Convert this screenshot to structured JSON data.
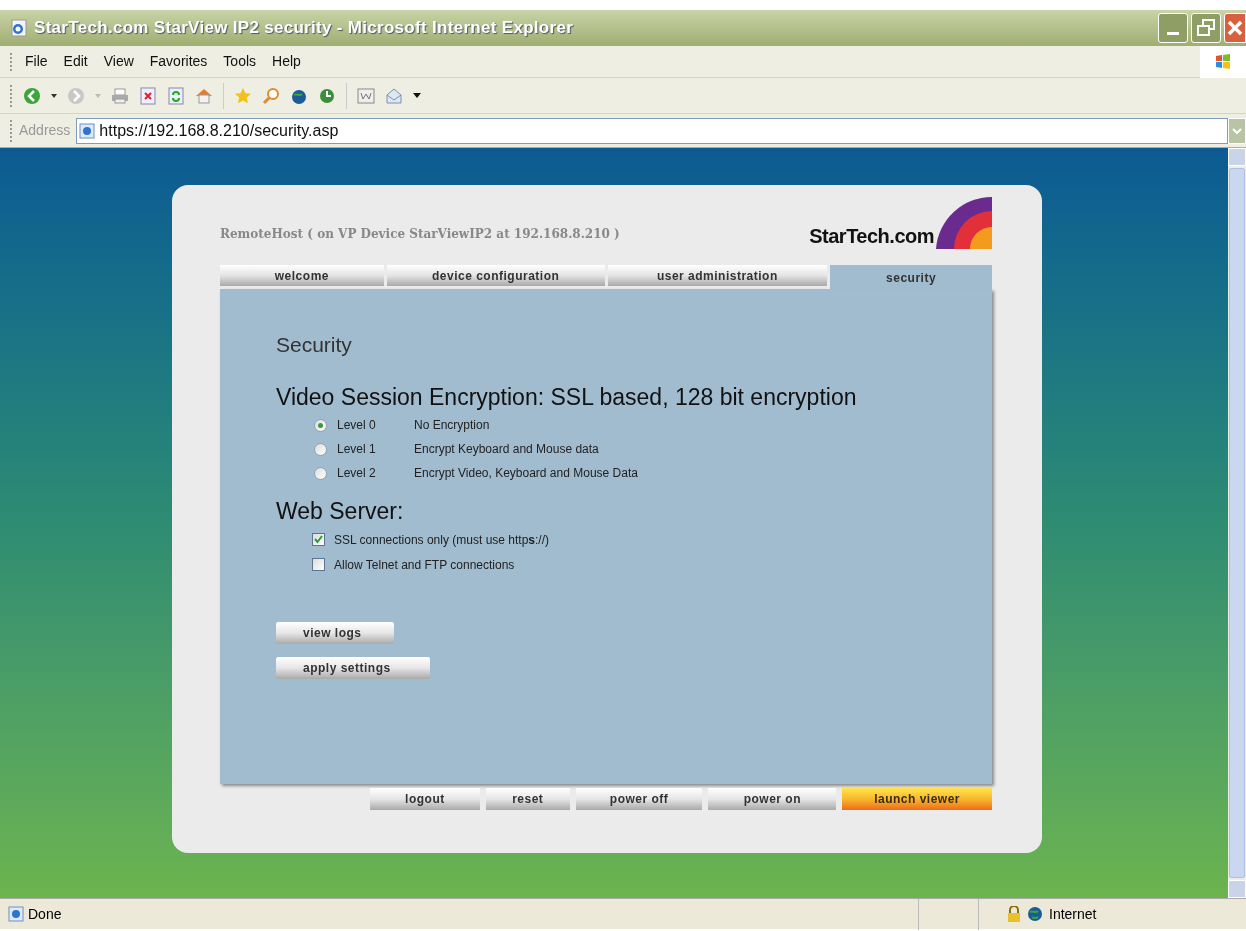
{
  "window": {
    "title": "StarTech.com StarView IP2 security - Microsoft Internet Explorer"
  },
  "menu": [
    "File",
    "Edit",
    "View",
    "Favorites",
    "Tools",
    "Help"
  ],
  "address": {
    "label": "Address",
    "value": "https://192.168.8.210/security.asp"
  },
  "page": {
    "host": "RemoteHost ( on VP Device StarViewIP2 at 192.168.8.210 )",
    "logo": "StarTech.com",
    "tabs": [
      {
        "label": "welcome",
        "selected": false
      },
      {
        "label": "device configuration",
        "selected": false
      },
      {
        "label": "user administration",
        "selected": false
      },
      {
        "label": "security",
        "selected": true
      }
    ],
    "heading": "Security",
    "encryption": {
      "title": "Video Session Encryption: SSL based, 128 bit encryption",
      "options": [
        {
          "level_label": "Level 0",
          "description": "No Encryption",
          "selected": true
        },
        {
          "level_label": "Level 1",
          "description": "Encrypt Keyboard and Mouse data",
          "selected": false
        },
        {
          "level_label": "Level 2",
          "description": "Encrypt Video, Keyboard and Mouse Data",
          "selected": false
        }
      ]
    },
    "web_server": {
      "title": "Web Server:",
      "options": [
        {
          "label": "SSL connections only (must use http**s**://)",
          "checked": true
        },
        {
          "label": "Allow Telnet and FTP connections",
          "checked": false
        }
      ]
    },
    "actions": [
      "view logs",
      "apply settings"
    ],
    "footer_buttons": [
      {
        "label": "logout",
        "kind": "normal"
      },
      {
        "label": "reset",
        "kind": "normal"
      },
      {
        "label": "power off",
        "kind": "normal"
      },
      {
        "label": "power on",
        "kind": "normal"
      },
      {
        "label": "launch viewer",
        "kind": "highlight"
      }
    ]
  },
  "status_bar": {
    "text": "Done",
    "zone": "Internet"
  }
}
